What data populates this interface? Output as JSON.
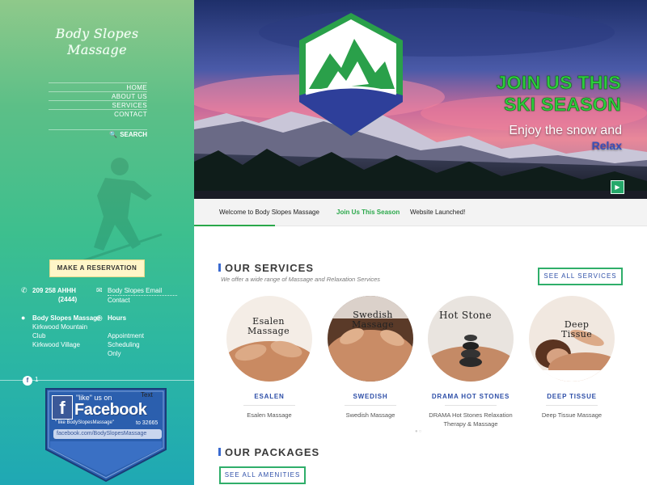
{
  "sidebar": {
    "logo_line1": "Body Slopes",
    "logo_line2": "Massage",
    "nav": [
      "HOME",
      "ABOUT US",
      "SERVICES",
      "CONTACT"
    ],
    "search_label": "SEARCH",
    "reservation_label": "MAKE A RESERVATION",
    "phone_line1": "209 258 AHHH",
    "phone_line2": "(2444)",
    "email_line1": "Body Slopes Email",
    "email_line2": "Contact",
    "location_title": "Body Slopes Massage",
    "location_line1": "Kirkwood Mountain",
    "location_line2": "Club",
    "location_line3": "Kirkwood Village",
    "hours_title": "Hours",
    "hours_line1": "Appointment",
    "hours_line2": "Scheduling",
    "hours_line3": "Only",
    "fb_count": "1",
    "fb_badge": {
      "like": "\"like\" us on",
      "word": "Facebook",
      "text_word": "Text",
      "note": "\" like BodySlopesMassage\"",
      "to_num": "to 32665",
      "url": "facebook.com/BodySlopesMassage"
    }
  },
  "hero": {
    "title_line1": "JOIN US THIS",
    "title_line2": "SKI SEASON",
    "sub_line1": "Enjoy the snow and",
    "sub_line2": "Relax"
  },
  "tabs": [
    "Welcome to Body Slopes Massage",
    "Join Us This Season",
    "Website Launched!"
  ],
  "services": {
    "title": "OUR SERVICES",
    "desc": "We offer a wide range of Massage and Relaxation Services",
    "see_all": "SEE ALL SERVICES",
    "items": [
      {
        "circle_l1": "Esalen",
        "circle_l2": "Massage",
        "name": "ESALEN",
        "desc": "Esalen Massage"
      },
      {
        "circle_l1": "Swedish",
        "circle_l2": "Massage",
        "name": "SWEDISH",
        "desc": "Swedish Massage"
      },
      {
        "circle_l1": "Hot Stone",
        "circle_l2": "",
        "name": "DRAMA HOT STONES",
        "desc": "DRAMA Hot Stones Relaxation Therapy & Massage"
      },
      {
        "circle_l1": "Deep",
        "circle_l2": "Tissue",
        "name": "DEEP TISSUE",
        "desc": "Deep Tissue Massage"
      }
    ]
  },
  "packages": {
    "title": "OUR PACKAGES",
    "see_all": "SEE ALL AMENITIES"
  },
  "colors": {
    "accent_green": "#2fae6a",
    "link_blue": "#2e4fa8",
    "hero_green": "#2ecc3d"
  }
}
